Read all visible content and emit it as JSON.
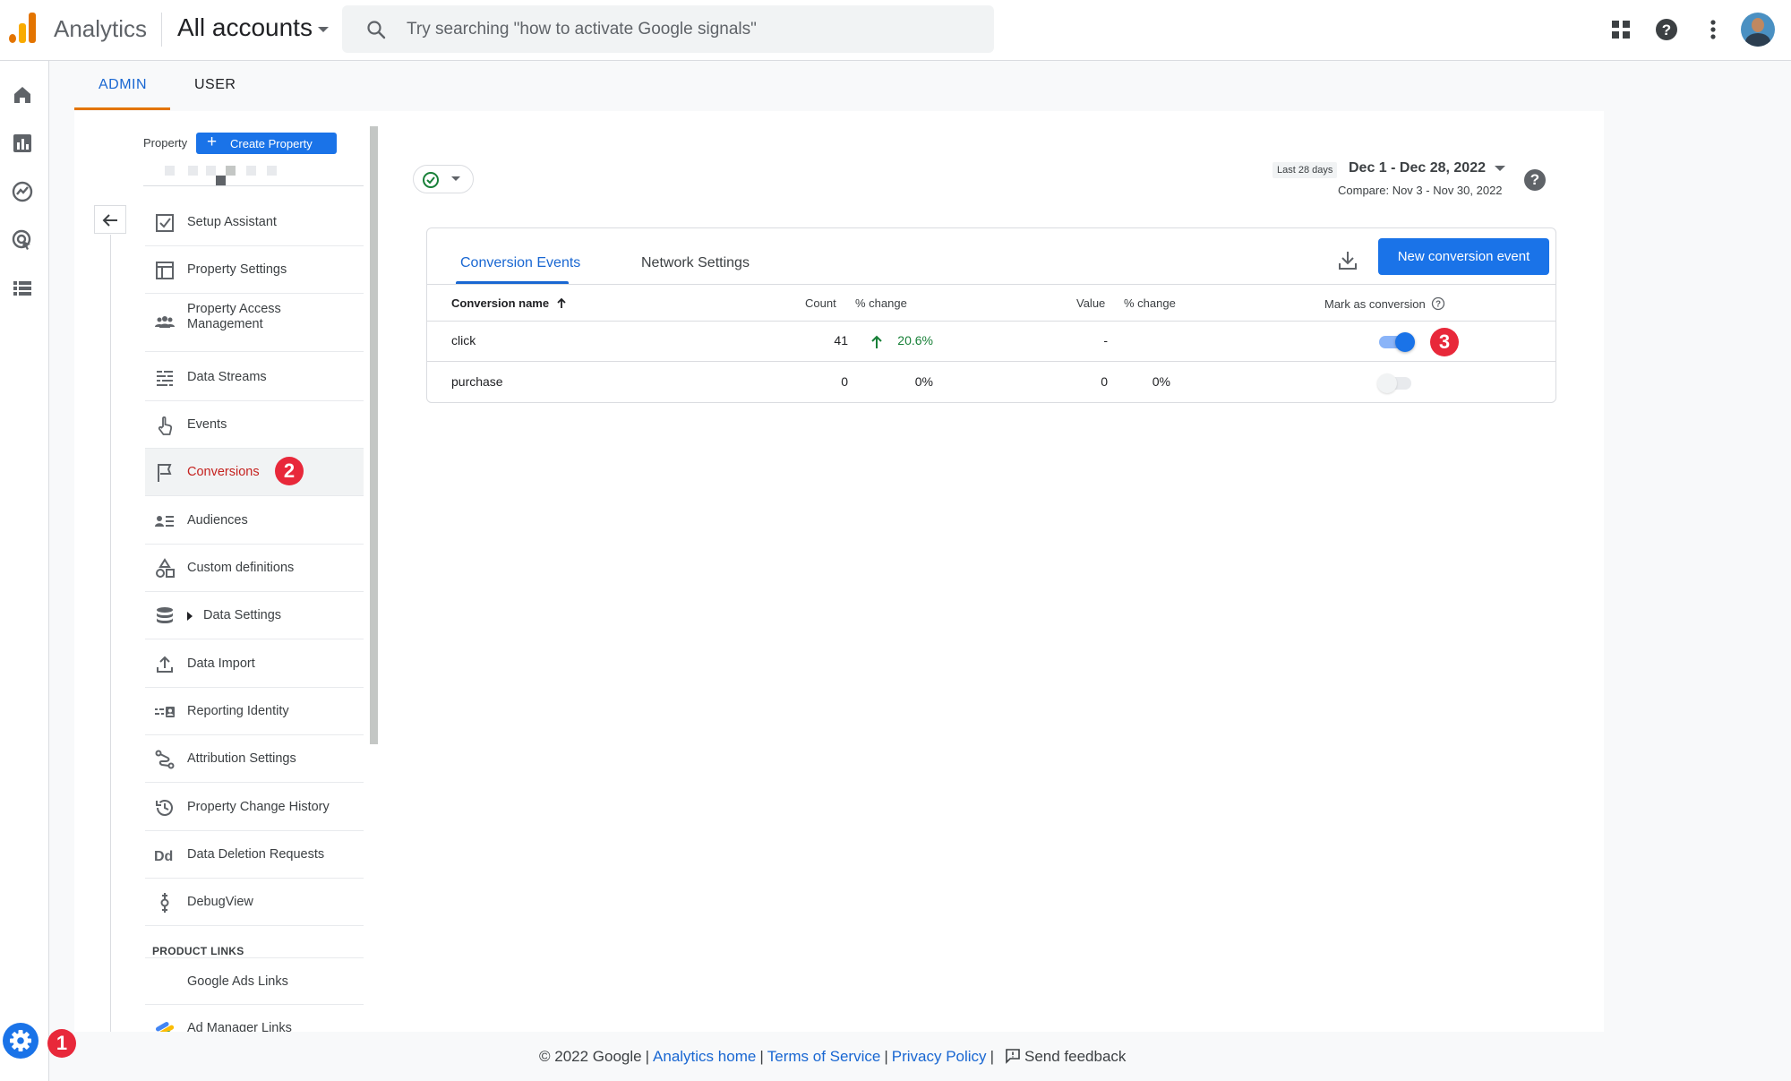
{
  "header": {
    "app_name": "Analytics",
    "account_selector": "All accounts",
    "search_placeholder": "Try searching \"how to activate Google signals\"",
    "icons": [
      "apps-grid-icon",
      "help-icon",
      "more-vert-icon",
      "avatar"
    ]
  },
  "rail": {
    "icons": [
      "home-icon",
      "reports-icon",
      "explore-icon",
      "advertising-icon",
      "configure-icon"
    ],
    "settings_badge": "1"
  },
  "admin_tabs": [
    {
      "label": "ADMIN",
      "active": true
    },
    {
      "label": "USER",
      "active": false
    }
  ],
  "sidebar": {
    "property_label": "Property",
    "create_property_label": "Create Property",
    "items": [
      {
        "label": "Setup Assistant",
        "icon": "checklist-icon"
      },
      {
        "label": "Property Settings",
        "icon": "layout-icon"
      },
      {
        "label": "Property Access Management",
        "icon": "people-icon"
      },
      {
        "label": "Data Streams",
        "icon": "streams-icon"
      },
      {
        "label": "Events",
        "icon": "touch-icon"
      },
      {
        "label": "Conversions",
        "icon": "flag-icon",
        "active": true,
        "badge": "2"
      },
      {
        "label": "Audiences",
        "icon": "audience-icon"
      },
      {
        "label": "Custom definitions",
        "icon": "shapes-icon"
      },
      {
        "label": "Data Settings",
        "icon": "database-icon",
        "expandable": true
      },
      {
        "label": "Data Import",
        "icon": "upload-icon"
      },
      {
        "label": "Reporting Identity",
        "icon": "identity-icon"
      },
      {
        "label": "Attribution Settings",
        "icon": "attribution-icon"
      },
      {
        "label": "Property Change History",
        "icon": "history-icon"
      },
      {
        "label": "Data Deletion Requests",
        "icon": "dd-icon"
      },
      {
        "label": "DebugView",
        "icon": "debug-icon"
      }
    ],
    "section_label": "PRODUCT LINKS",
    "links": [
      {
        "label": "Google Ads Links"
      },
      {
        "label": "Ad Manager Links",
        "icon": "ad-manager-icon"
      }
    ]
  },
  "date": {
    "range_label": "Last 28 days",
    "range": "Dec 1 - Dec 28, 2022",
    "compare": "Compare: Nov 3 - Nov 30, 2022"
  },
  "card": {
    "tabs": [
      {
        "label": "Conversion Events",
        "active": true
      },
      {
        "label": "Network Settings",
        "active": false
      }
    ],
    "new_button": "New conversion event",
    "columns": {
      "name": "Conversion name",
      "count": "Count",
      "count_change": "% change",
      "value": "Value",
      "value_change": "% change",
      "mark": "Mark as conversion"
    },
    "rows": [
      {
        "name": "click",
        "count": "41",
        "count_change": "20.6%",
        "trend": "up",
        "value": "-",
        "value_change": "",
        "marked": true,
        "badge": "3"
      },
      {
        "name": "purchase",
        "count": "0",
        "count_change": "0%",
        "trend": "",
        "value": "0",
        "value_change": "0%",
        "marked": false
      }
    ]
  },
  "footer": {
    "copyright": "© 2022 Google",
    "links": [
      "Analytics home",
      "Terms of Service",
      "Privacy Policy"
    ],
    "feedback": "Send feedback"
  },
  "colors": {
    "accent": "#1a73e8",
    "active_nav": "#c5221f",
    "badge": "#e8283a",
    "positive": "#188038",
    "tab_underline": "#e37400"
  }
}
